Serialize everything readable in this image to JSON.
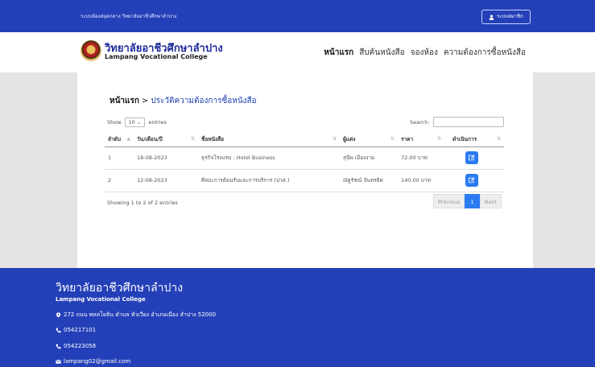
{
  "topbar": {
    "site_name": "ระบบห้องสมุดกลาง วิทยาลัยอาชีวศึกษาลำปาง",
    "member_label": "ระบบสมาชิก"
  },
  "header": {
    "college_th": "วิทยาลัยอาชีวศึกษาลำปาง",
    "college_en": "Lampang Vocational College",
    "nav": [
      "หน้าแรก",
      "สืบค้นหนังสือ",
      "จองห้อง",
      "ความต้องการซื้อหนังสือ"
    ]
  },
  "breadcrumb": {
    "home": "หน้าแรก",
    "separator": ">",
    "current": "ประวัติความต้องการซื้อหนังสือ"
  },
  "datatable": {
    "show_label": "Show",
    "entries_value": "10",
    "entries_label": "entries",
    "search_label": "Search:",
    "search_value": "",
    "columns": [
      "ลำดับ",
      "วัน/เดือน/ปี",
      "ชื่อหนังสือ",
      "ผู้แต่ง",
      "ราคา",
      "ดำเนินการ"
    ],
    "rows": [
      [
        "1",
        "18-08-2023",
        "ธุรกิจโรงแรม : Hotel Business",
        "สุนีพ เมืองงาม",
        "72.00 บาท"
      ],
      [
        "2",
        "12-08-2023",
        "ศิลปะการต้อนรับและการบริการ (ปวส.)",
        "ณัฐรัชณ์ จันทรธิต",
        "140.00 บาท"
      ]
    ],
    "info": "Showing 1 to 2 of 2 entries",
    "pager": {
      "previous": "Previous",
      "current": "1",
      "next": "Next"
    }
  },
  "footer": {
    "name_th": "วิทยาลัยอาชีวศึกษาลำปาง",
    "name_en": "Lampang Vocational College",
    "address": "272 ถนน พหลโยธิน ตำบล หัวเวียง อำเภอเมือง ลำปาง 52000",
    "phone1": "054217101",
    "phone2": "054223058",
    "email": "lampang02@gmail.com"
  },
  "colors": {
    "brand_blue": "#2440b8",
    "button_blue": "#2b7bf3"
  },
  "icons": [
    "user-icon",
    "sort-icon",
    "edit-icon",
    "map-marker-icon",
    "phone-icon",
    "envelope-icon"
  ]
}
